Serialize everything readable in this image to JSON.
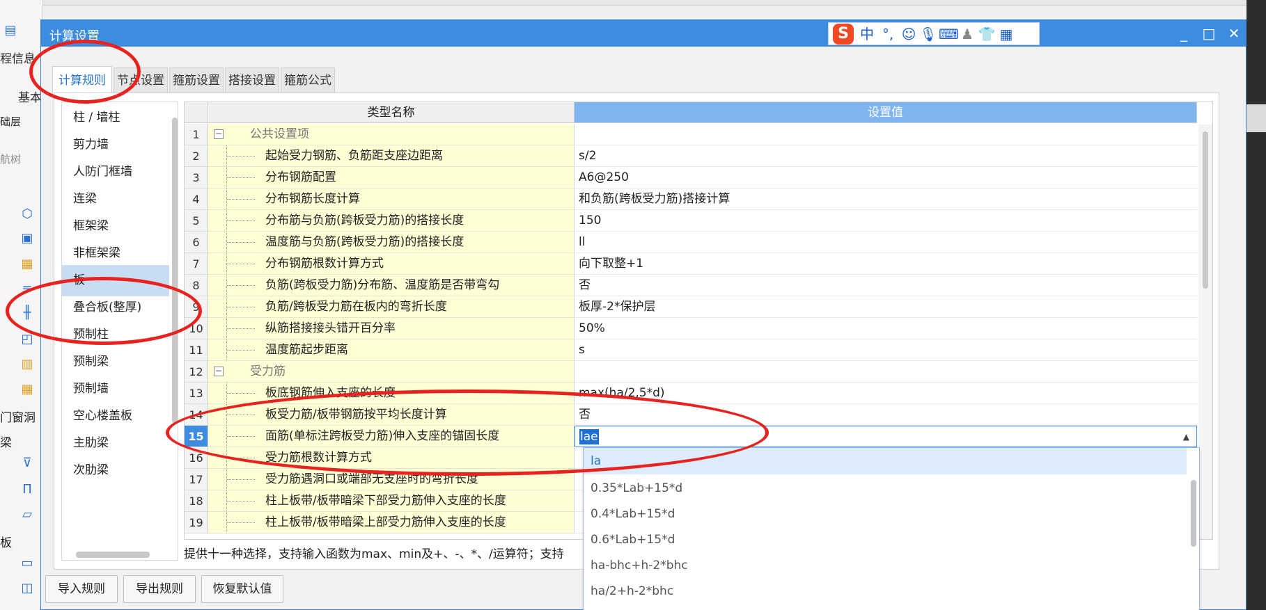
{
  "background": {
    "left_labels": [
      "程信息",
      "基本",
      "础层",
      "航树",
      "门窗洞",
      "梁",
      "板"
    ]
  },
  "dialog": {
    "title": "计算设置",
    "ime": {
      "brand": "S",
      "mode": "中",
      "punct": "°,"
    },
    "window_controls": {
      "minimize": "_",
      "maximize": "□",
      "close": "✕"
    },
    "tabs": [
      "计算规则",
      "节点设置",
      "箍筋设置",
      "搭接设置",
      "箍筋公式"
    ],
    "categories": [
      "柱 / 墙柱",
      "剪力墙",
      "人防门框墙",
      "连梁",
      "框架梁",
      "非框架梁",
      "板",
      "叠合板(整厚)",
      "预制柱",
      "预制梁",
      "预制墙",
      "空心楼盖板",
      "主肋梁",
      "次肋梁"
    ],
    "active_category": "板",
    "grid": {
      "headers": [
        "类型名称",
        "设置值"
      ],
      "rows": [
        {
          "num": "1",
          "name": "公共设置项",
          "value": "",
          "group": true
        },
        {
          "num": "2",
          "name": "起始受力钢筋、负筋距支座边距离",
          "value": "s/2"
        },
        {
          "num": "3",
          "name": "分布钢筋配置",
          "value": "A6@250"
        },
        {
          "num": "4",
          "name": "分布钢筋长度计算",
          "value": "和负筋(跨板受力筋)搭接计算"
        },
        {
          "num": "5",
          "name": "分布筋与负筋(跨板受力筋)的搭接长度",
          "value": "150"
        },
        {
          "num": "6",
          "name": "温度筋与负筋(跨板受力筋)的搭接长度",
          "value": "ll"
        },
        {
          "num": "7",
          "name": "分布钢筋根数计算方式",
          "value": "向下取整+1"
        },
        {
          "num": "8",
          "name": "负筋(跨板受力筋)分布筋、温度筋是否带弯勾",
          "value": "否"
        },
        {
          "num": "9",
          "name": "负筋/跨板受力筋在板内的弯折长度",
          "value": "板厚-2*保护层"
        },
        {
          "num": "10",
          "name": "纵筋搭接接头错开百分率",
          "value": "50%"
        },
        {
          "num": "11",
          "name": "温度筋起步距离",
          "value": "s"
        },
        {
          "num": "12",
          "name": "受力筋",
          "value": "",
          "group": true
        },
        {
          "num": "13",
          "name": "板底钢筋伸入支座的长度",
          "value": "max(ha/2,5*d)"
        },
        {
          "num": "14",
          "name": "板受力筋/板带钢筋按平均长度计算",
          "value": "否"
        },
        {
          "num": "15",
          "name": "面筋(单标注跨板受力筋)伸入支座的锚固长度",
          "value": "lae",
          "selected": true
        },
        {
          "num": "16",
          "name": "受力筋根数计算方式",
          "value": ""
        },
        {
          "num": "17",
          "name": "受力筋遇洞口或端部无支座时的弯折长度",
          "value": ""
        },
        {
          "num": "18",
          "name": "柱上板带/板带暗梁下部受力筋伸入支座的长度",
          "value": ""
        },
        {
          "num": "19",
          "name": "柱上板带/板带暗梁上部受力筋伸入支座的长度",
          "value": ""
        }
      ]
    },
    "dropdown_options": [
      "la",
      "0.35*Lab+15*d",
      "0.4*Lab+15*d",
      "0.6*Lab+15*d",
      "ha-bhc+h-2*bhc",
      "ha/2+h-2*bhc"
    ],
    "hint": "提供十一种选择，支持输入函数为max、min及+、-、*、/运算符；支持",
    "buttons": {
      "import": "导入规则",
      "export": "导出规则",
      "restore": "恢复默认值"
    }
  }
}
